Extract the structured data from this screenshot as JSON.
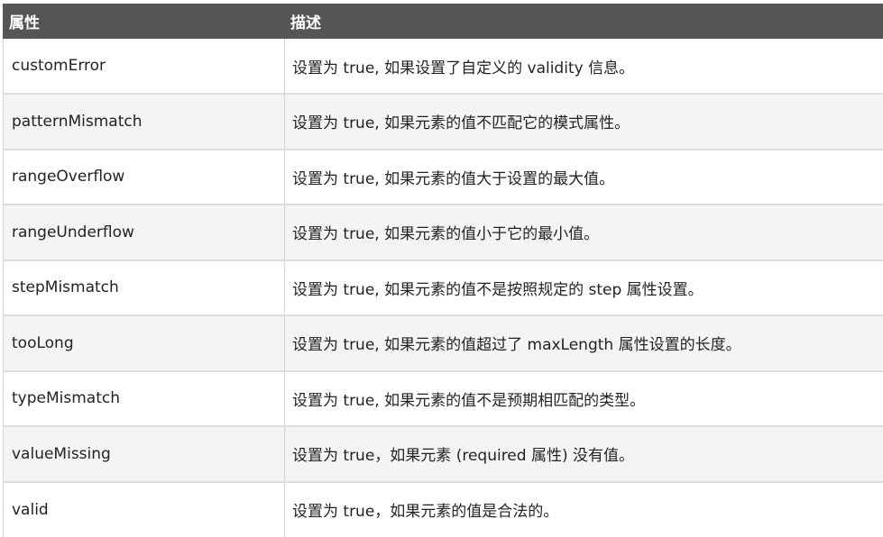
{
  "table": {
    "headers": [
      "属性",
      "描述"
    ],
    "rows": [
      {
        "property": "customError",
        "description": "设置为 true, 如果设置了自定义的 validity 信息。"
      },
      {
        "property": "patternMismatch",
        "description": "设置为 true, 如果元素的值不匹配它的模式属性。"
      },
      {
        "property": "rangeOverflow",
        "description": "设置为 true, 如果元素的值大于设置的最大值。"
      },
      {
        "property": "rangeUnderflow",
        "description": "设置为 true, 如果元素的值小于它的最小值。"
      },
      {
        "property": "stepMismatch",
        "description": "设置为 true, 如果元素的值不是按照规定的 step 属性设置。"
      },
      {
        "property": "tooLong",
        "description": "设置为 true, 如果元素的值超过了 maxLength 属性设置的长度。"
      },
      {
        "property": "typeMismatch",
        "description": "设置为 true, 如果元素的值不是预期相匹配的类型。"
      },
      {
        "property": "valueMissing",
        "description": "设置为 true，如果元素 (required 属性) 没有值。"
      },
      {
        "property": "valid",
        "description": "设置为 true，如果元素的值是合法的。"
      }
    ]
  }
}
